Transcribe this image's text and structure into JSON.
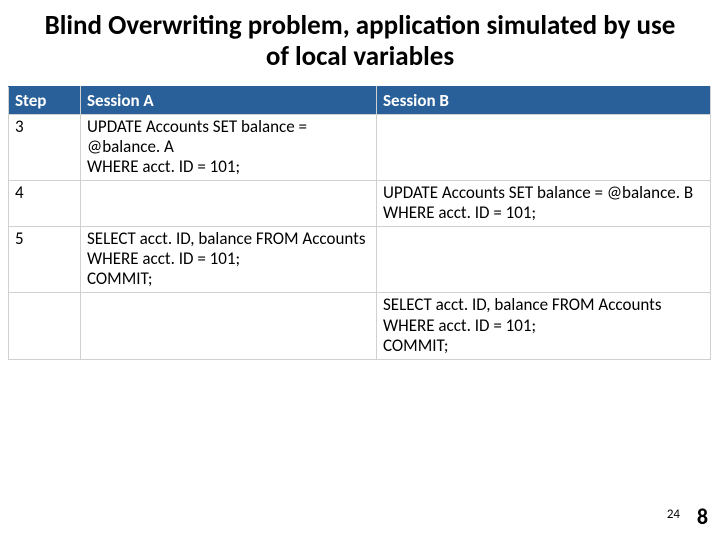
{
  "title": "Blind Overwriting problem, application simulated by use of local variables",
  "headers": {
    "step": "Step",
    "sessionA": "Session A",
    "sessionB": "Session B"
  },
  "rows": [
    {
      "step": "3",
      "a": "UPDATE Accounts SET balance = @balance. A\nWHERE acct. ID = 101;",
      "b": ""
    },
    {
      "step": "4",
      "a": "",
      "b": "UPDATE Accounts SET balance = @balance. B\nWHERE acct. ID = 101;"
    },
    {
      "step": "5",
      "a": "SELECT acct. ID, balance FROM Accounts\nWHERE acct. ID = 101;\nCOMMIT;",
      "b": ""
    },
    {
      "step": "",
      "a": "",
      "b": "SELECT acct. ID, balance FROM Accounts\nWHERE acct. ID = 101;\nCOMMIT;"
    }
  ],
  "page": {
    "small": "24",
    "big": "8"
  }
}
